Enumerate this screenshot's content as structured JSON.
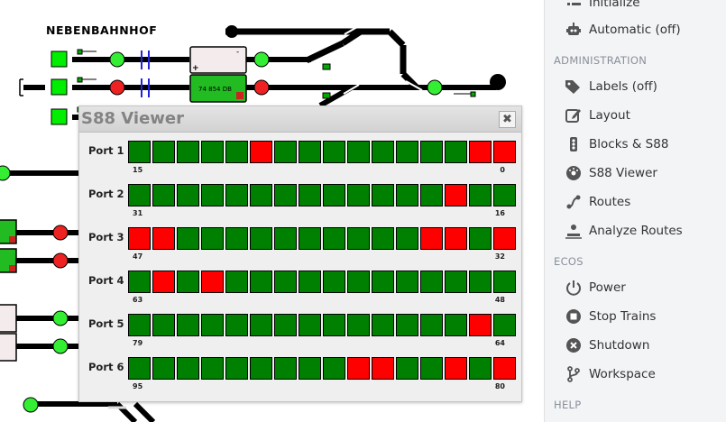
{
  "layout": {
    "station_name": "NEBENBAHNHOF",
    "train_number": "74 854 DB"
  },
  "dialog": {
    "title": "S88 Viewer",
    "close_symbol": "✖",
    "ports": [
      {
        "label": "Port 1",
        "low": "15",
        "high": "0",
        "states": [
          0,
          0,
          0,
          0,
          0,
          1,
          0,
          0,
          0,
          0,
          0,
          0,
          0,
          0,
          1,
          1
        ]
      },
      {
        "label": "Port 2",
        "low": "31",
        "high": "16",
        "states": [
          0,
          0,
          0,
          0,
          0,
          0,
          0,
          0,
          0,
          0,
          0,
          0,
          0,
          1,
          0,
          0
        ]
      },
      {
        "label": "Port 3",
        "low": "47",
        "high": "32",
        "states": [
          1,
          1,
          0,
          0,
          0,
          0,
          0,
          0,
          0,
          0,
          0,
          0,
          1,
          1,
          0,
          1
        ]
      },
      {
        "label": "Port 4",
        "low": "63",
        "high": "48",
        "states": [
          0,
          1,
          0,
          1,
          0,
          0,
          0,
          0,
          0,
          0,
          0,
          0,
          0,
          0,
          0,
          0
        ]
      },
      {
        "label": "Port 5",
        "low": "79",
        "high": "64",
        "states": [
          0,
          0,
          0,
          0,
          0,
          0,
          0,
          0,
          0,
          0,
          0,
          0,
          0,
          0,
          1,
          0
        ]
      },
      {
        "label": "Port 6",
        "low": "95",
        "high": "80",
        "states": [
          0,
          0,
          0,
          0,
          0,
          0,
          0,
          0,
          0,
          1,
          1,
          0,
          0,
          1,
          0,
          1
        ]
      }
    ],
    "colors": {
      "off": "#008000",
      "on": "#ff0000"
    }
  },
  "sidebar": {
    "partial_top": "Initialize",
    "automatic": "Automatic (off)",
    "sections": {
      "administration": "ADMINISTRATION",
      "ecos": "ECOS",
      "help": "HELP"
    },
    "admin_items": [
      {
        "label": "Labels (off)",
        "icon": "tag-icon"
      },
      {
        "label": "Layout",
        "icon": "edit-icon"
      },
      {
        "label": "Blocks & S88",
        "icon": "traffic-light-icon"
      },
      {
        "label": "S88 Viewer",
        "icon": "dashboard-icon"
      },
      {
        "label": "Routes",
        "icon": "route-icon"
      },
      {
        "label": "Analyze Routes",
        "icon": "analyze-icon"
      }
    ],
    "ecos_items": [
      {
        "label": "Power",
        "icon": "power-icon"
      },
      {
        "label": "Stop Trains",
        "icon": "stop-icon"
      },
      {
        "label": "Shutdown",
        "icon": "shutdown-icon"
      },
      {
        "label": "Workspace",
        "icon": "workspace-icon"
      }
    ]
  }
}
